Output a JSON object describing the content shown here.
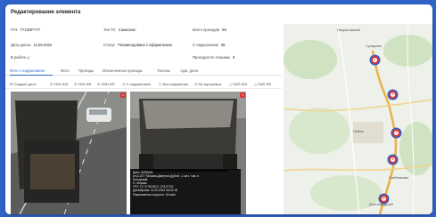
{
  "colors": {
    "accent": "#2f63c8",
    "alert": "#d63a3a",
    "pin": "#d93535"
  },
  "window": {
    "title": "Редактирование элемента"
  },
  "fields": {
    "grz_label": "ГРЗ",
    "grz_value": "Т710ОР777",
    "type_label": "Тип ТС",
    "type_value": "Самосвал",
    "total_label": "Всего проездов",
    "total_value": "89",
    "date_label": "Дата доклы",
    "date_value": "11.09.2022",
    "status_label": "Статус",
    "status_value": "Рекомендовано к оформлению",
    "violations_label": "С нарушением",
    "violations_value": "35",
    "work_label": "В работе у",
    "tonnage_label": "Проездов по тоннаже",
    "tonnage_value": "0"
  },
  "tabs": [
    "Фото с нарушением",
    "Фото",
    "Проезды",
    "Исключенные проезды",
    "Талоны",
    "Адм. дела"
  ],
  "actions": [
    "Создать дело",
    "УИН ЮЛ",
    "УИН ФЛ",
    "УИН ИП",
    "С нарушением",
    "Без нарушения",
    "Не мусоровоз",
    "ПАП ЮЛ",
    "ПАП ФЛ"
  ],
  "photo_caption": "Дата: А206026\nул.А-107 \"Москва-Дмитров-Дубна\", 1 км 1 т.км, н.\nАхтырский\nН. Москва\nГРЗ: Т0 7У ВОЧЕЛ, 17/1/Т/Т/0\nДата/Время: 11.09.2022 08:22:18\nРазрешенная скорость: 60 км/ч",
  "map": {
    "labels": [
      "Некрасовский",
      "Сухарево",
      "Лобня",
      "Хлебниково",
      "Долгопрудный"
    ],
    "pins": [
      "1",
      "2",
      "3",
      "4",
      "5"
    ]
  }
}
